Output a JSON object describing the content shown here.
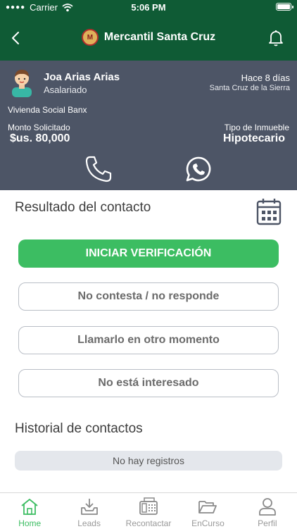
{
  "status_bar": {
    "carrier": "Carrier",
    "time": "5:06 PM"
  },
  "header": {
    "brand_name": "Mercantil Santa Cruz",
    "logo_text": "M"
  },
  "client": {
    "name": "Joa Arias Arias",
    "role": "Asalariado",
    "time_ago": "Hace 8 días",
    "city": "Santa Cruz de la Sierra",
    "product": "Vivienda Social Banx",
    "amount_label": "Monto Solicitado",
    "amount": "$us. 80,000",
    "property_label": "Tipo de Inmueble",
    "property_type": "Hipotecario"
  },
  "contact_result": {
    "title": "Resultado del contacto",
    "start_button": "INICIAR VERIFICACIÓN",
    "options": [
      "No contesta / no responde",
      "Llamarlo en otro momento",
      "No está interesado"
    ]
  },
  "history": {
    "title": "Historial de contactos",
    "empty": "No hay registros"
  },
  "tabs": [
    {
      "label": "Home",
      "icon": "home-icon",
      "active": true
    },
    {
      "label": "Leads",
      "icon": "inbox-download-icon",
      "active": false
    },
    {
      "label": "Recontactar",
      "icon": "fax-phone-icon",
      "active": false
    },
    {
      "label": "EnCurso",
      "icon": "folder-open-icon",
      "active": false
    },
    {
      "label": "Perfil",
      "icon": "user-icon",
      "active": false
    }
  ],
  "colors": {
    "brand_green": "#0f5b35",
    "accent_green": "#3cbd62",
    "client_panel": "#4d5566"
  }
}
